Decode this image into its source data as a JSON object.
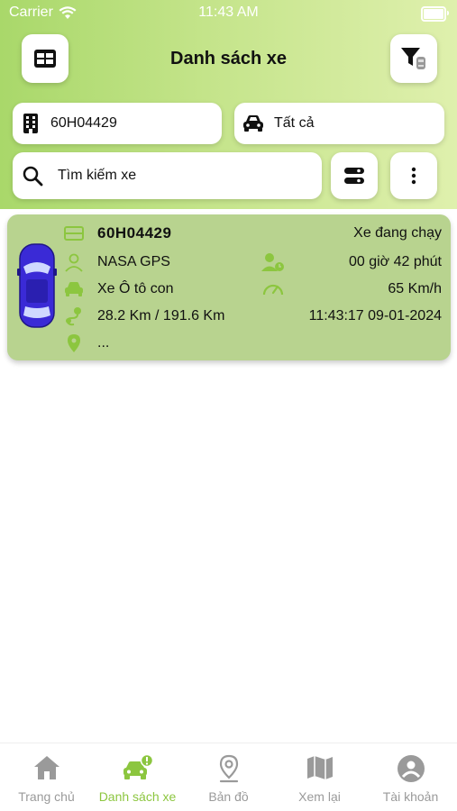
{
  "status_bar": {
    "carrier": "Carrier",
    "time": "11:43 AM"
  },
  "header": {
    "title": "Danh sách xe"
  },
  "filters": {
    "plate_value": "60H04429",
    "vehicle_type_value": "Tất cả",
    "search_placeholder": "Tìm kiếm xe"
  },
  "vehicles": [
    {
      "plate": "60H04429",
      "status": "Xe đang chạy",
      "provider": "NASA GPS",
      "duration": "00 giờ 42 phút",
      "vehicle_type": "Xe Ô tô con",
      "speed": "65 Km/h",
      "distance": "28.2 Km / 191.6 Km",
      "timestamp": "11:43:17 09-01-2024",
      "address": "..."
    }
  ],
  "tabbar": {
    "items": [
      {
        "label": "Trang chủ",
        "icon": "home-icon",
        "active": false
      },
      {
        "label": "Danh sách xe",
        "icon": "car-alert-icon",
        "active": true
      },
      {
        "label": "Bản đồ",
        "icon": "location-pin-icon",
        "active": false
      },
      {
        "label": "Xem lại",
        "icon": "map-icon",
        "active": false
      },
      {
        "label": "Tài khoản",
        "icon": "account-icon",
        "active": false
      }
    ]
  },
  "colors": {
    "accent": "#8cc63f",
    "card_bg": "#b8d38f",
    "header_gradient_start": "#a9d86a",
    "header_gradient_end": "#dff0ad",
    "car_blue": "#3a2ad6"
  }
}
